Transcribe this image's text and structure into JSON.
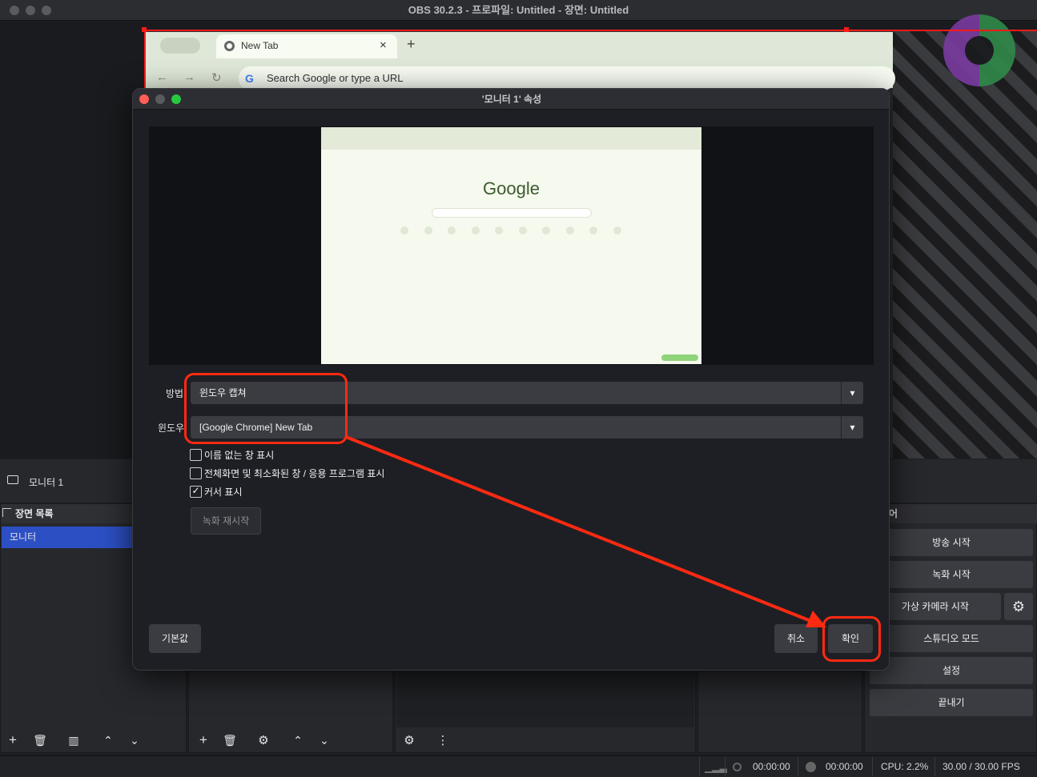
{
  "window": {
    "title": "OBS 30.2.3 - 프로파일: Untitled - 장면: Untitled"
  },
  "browser": {
    "tab_title": "New Tab",
    "address_placeholder": "Search Google or type a URL"
  },
  "dialog": {
    "title": "'모니터 1' 속성",
    "preview": {
      "logo_text": "Google"
    },
    "method_label": "방법",
    "method_value": "윈도우 캡쳐",
    "window_label": "윈도우",
    "window_value": "[Google Chrome] New Tab",
    "checkboxes": [
      {
        "label": "이름 없는 창 표시",
        "checked": false
      },
      {
        "label": "전체화면 및 최소화된 창 / 응용 프로그램 표시",
        "checked": false
      },
      {
        "label": "커서 표시",
        "checked": true
      }
    ],
    "restart_button": "녹화 재시작",
    "defaults_button": "기본값",
    "cancel_button": "취소",
    "ok_button": "확인"
  },
  "source_bar": {
    "source_name": "모니터 1"
  },
  "scenes": {
    "header": "장면 목록",
    "items": [
      "모니터"
    ]
  },
  "controls": {
    "header_partial": "어",
    "buttons": [
      "방송 시작",
      "녹화 시작",
      "가상 카메라 시작",
      "스튜디오 모드",
      "설정",
      "끝내기"
    ]
  },
  "status": {
    "stream_time": "00:00:00",
    "record_time": "00:00:00",
    "cpu": "CPU: 2.2%",
    "fps": "30.00 / 30.00 FPS"
  },
  "colors": {
    "accent": "#2c4fc4",
    "annotation": "#ff2a12",
    "chrome_frame": "#dfe8d8"
  }
}
